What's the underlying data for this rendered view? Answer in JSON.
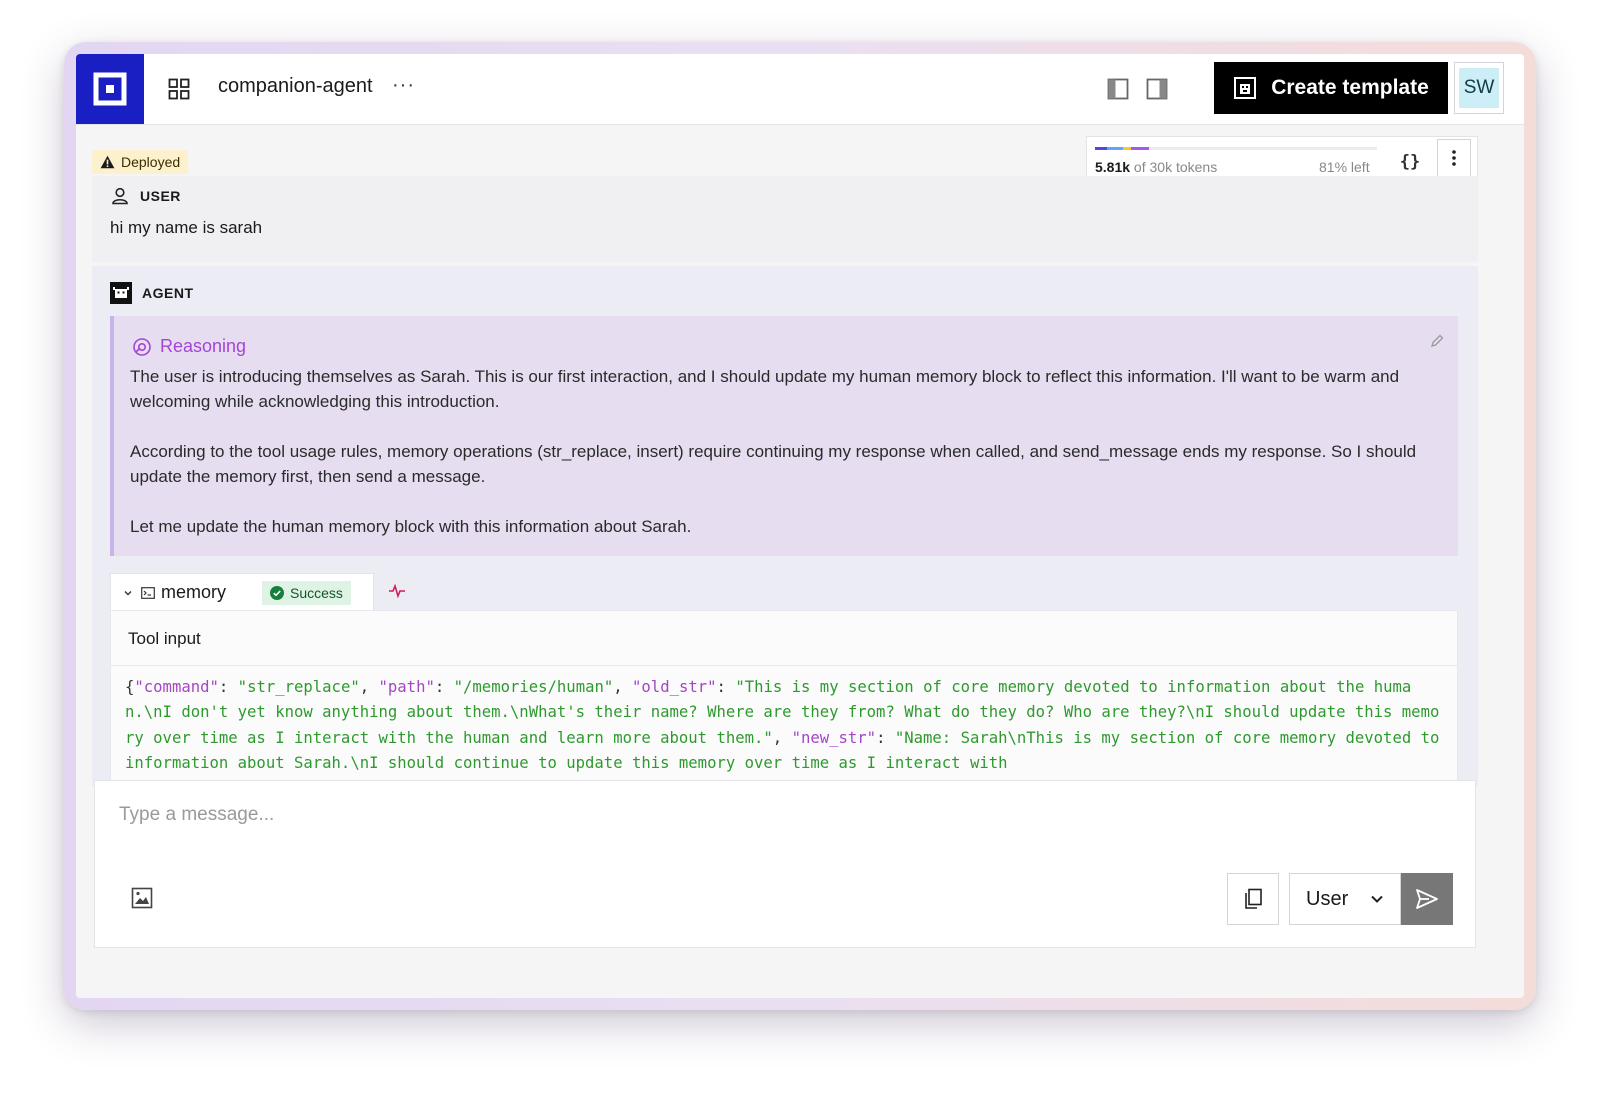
{
  "header": {
    "agent_name": "companion-agent",
    "more_label": "···",
    "create_template_label": "Create template",
    "avatar_initials": "SW"
  },
  "context": {
    "used": "5.81k",
    "of_total": " of 30k tokens",
    "remaining": "81% left",
    "braces_label": "{}",
    "usage_segments": [
      {
        "color": "#4f46e5"
      },
      {
        "color": "#60a5fa"
      },
      {
        "color": "#facc15"
      },
      {
        "color": "#a855f7"
      }
    ]
  },
  "status": {
    "deployed_label": "Deployed"
  },
  "messages": {
    "user": {
      "role": "USER",
      "text": "hi my name is sarah"
    },
    "agent": {
      "role": "AGENT",
      "reasoning": {
        "title": "Reasoning",
        "paragraphs": [
          "The user is introducing themselves as Sarah. This is our first interaction, and I should update my human memory block to reflect this information. I'll want to be warm and welcoming while acknowledging this introduction.",
          "According to the tool usage rules, memory operations (str_replace, insert) require continuing my response when called, and send_message ends my response. So I should update the memory first, then send a message.",
          "Let me update the human memory block with this information about Sarah."
        ]
      },
      "tool_call": {
        "name": "memory",
        "status": "Success",
        "input_label": "Tool input",
        "input": {
          "command": "str_replace",
          "path": "/memories/human",
          "old_str": "This is my section of core memory devoted to information about the human.\\nI don't yet know anything about them.\\nWhat's their name? Where are they from? What do they do? Who are they?\\nI should update this memory over time as I interact with the human and learn more about them.",
          "new_str": "Name: Sarah\\nThis is my section of core memory devoted to information about Sarah.\\nI should continue to update this memory over time as I interact with"
        }
      }
    }
  },
  "composer": {
    "placeholder": "Type a message...",
    "role_value": "User"
  },
  "colors": {
    "brand": "#1a1fc4",
    "reasoning_accent": "#a346d6",
    "success": "#15803d"
  }
}
